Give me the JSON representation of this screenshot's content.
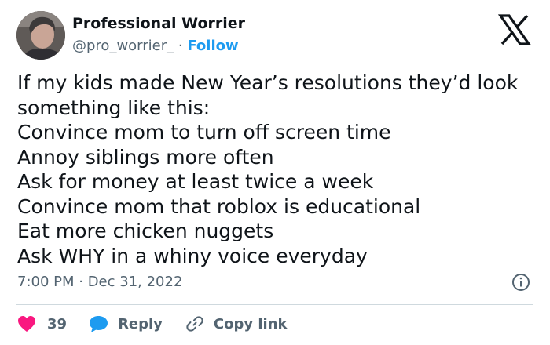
{
  "author": {
    "name": "Professional Worrier",
    "handle": "@pro_worrier_",
    "separator": "·",
    "follow_label": "Follow"
  },
  "tweet": {
    "lines": [
      "If my kids made New Year’s resolutions they’d look",
      "something like this:",
      "Convince mom to turn off screen time",
      "Annoy siblings more often",
      "Ask for money at least twice a week",
      "Convince mom that roblox is educational",
      "Eat more chicken nuggets",
      "Ask WHY in a whiny voice everyday"
    ],
    "timestamp": "7:00 PM · Dec 31, 2022"
  },
  "actions": {
    "like_count": "39",
    "reply_label": "Reply",
    "copy_label": "Copy link"
  },
  "icons": {
    "brand": "x-logo-icon",
    "info": "info-icon",
    "like": "heart-icon",
    "reply": "speech-bubble-icon",
    "copy": "link-icon"
  },
  "colors": {
    "text": "#0f1419",
    "secondary": "#536471",
    "accent": "#1d9bf0",
    "like": "#f91880",
    "divider": "#cfd9de"
  }
}
